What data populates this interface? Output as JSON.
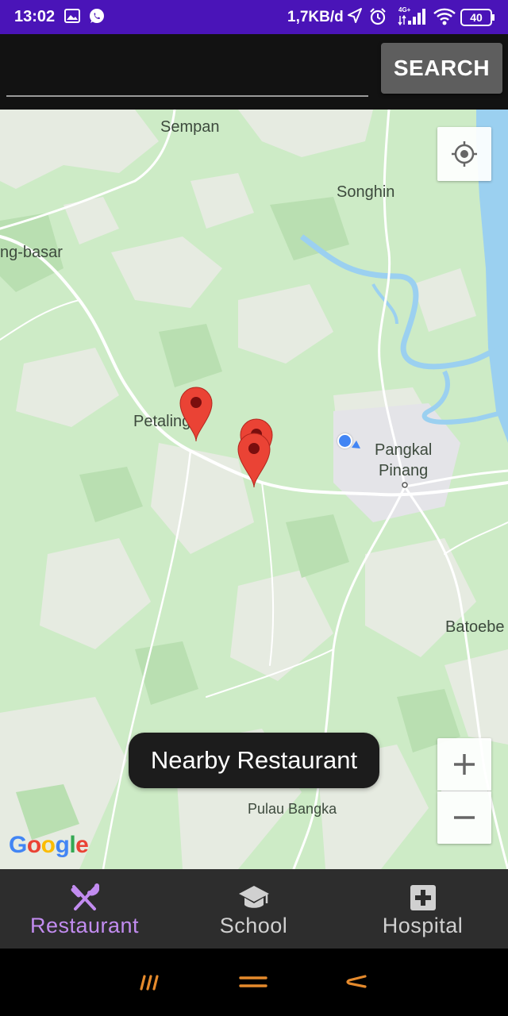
{
  "status_bar": {
    "time": "13:02",
    "network_speed": "1,7KB/d",
    "battery": "40",
    "icons": [
      "gallery-icon",
      "whatsapp-icon",
      "navigation-icon",
      "alarm-icon",
      "signal-4g-icon",
      "wifi-icon",
      "battery-icon"
    ]
  },
  "search": {
    "placeholder": "",
    "value": "",
    "button_label": "SEARCH"
  },
  "map": {
    "labels": {
      "sempan": "Sempan",
      "songhin": "Songhin",
      "basar": "ng-basar",
      "petaling": "Petaling",
      "pangkal": "Pangkal",
      "pinang": "Pinang",
      "batoebe": "Batoebe",
      "pulau_bangka": "Pulau Bangka"
    },
    "markers_count": 3,
    "attribution": "Google",
    "controls": {
      "zoom_in": "+",
      "zoom_out": "−"
    },
    "colors": {
      "land": "#cdebc6",
      "forest_dark": "#b8e0b0",
      "clearing": "#e9eae4",
      "water": "#9bd0f0",
      "marker": "#ea4335",
      "location": "#4285f4"
    }
  },
  "toast": {
    "text": "Nearby Restaurant"
  },
  "bottom_nav": {
    "active_color": "#c28cf0",
    "inactive_color": "#d0d0d0",
    "items": [
      {
        "label": "Restaurant",
        "icon": "restaurant-icon",
        "active": true
      },
      {
        "label": "School",
        "icon": "school-icon",
        "active": false
      },
      {
        "label": "Hospital",
        "icon": "hospital-icon",
        "active": false
      }
    ]
  },
  "system_nav": {
    "icons": [
      "recent-apps-icon",
      "home-icon",
      "back-icon"
    ],
    "color": "#e58a2c"
  }
}
